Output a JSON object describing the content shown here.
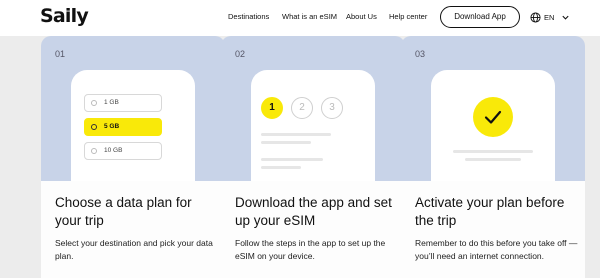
{
  "header": {
    "logo": "Saily",
    "nav": [
      "Destinations",
      "What is an eSIM",
      "About Us",
      "Help center"
    ],
    "download_button": "Download App",
    "language": "EN"
  },
  "cards": [
    {
      "number": "01",
      "title": "Choose a data plan for your trip",
      "description": "Select your destination and pick your data plan.",
      "plans": [
        "1 GB",
        "5 GB",
        "10 GB"
      ],
      "selected_plan": "5 GB"
    },
    {
      "number": "02",
      "title": "Download the app and set up your eSIM",
      "description": "Follow the steps in the app to set up the eSIM on your device.",
      "steps": [
        "1",
        "2",
        "3"
      ],
      "active_step": "1"
    },
    {
      "number": "03",
      "title": "Activate your plan before the trip",
      "description": "Remember to do this before you take off — you’ll need an internet connection."
    }
  ],
  "colors": {
    "accent": "#f9e909",
    "card_illustration_bg": "#c8d3e8",
    "page_bg": "#ececec"
  }
}
